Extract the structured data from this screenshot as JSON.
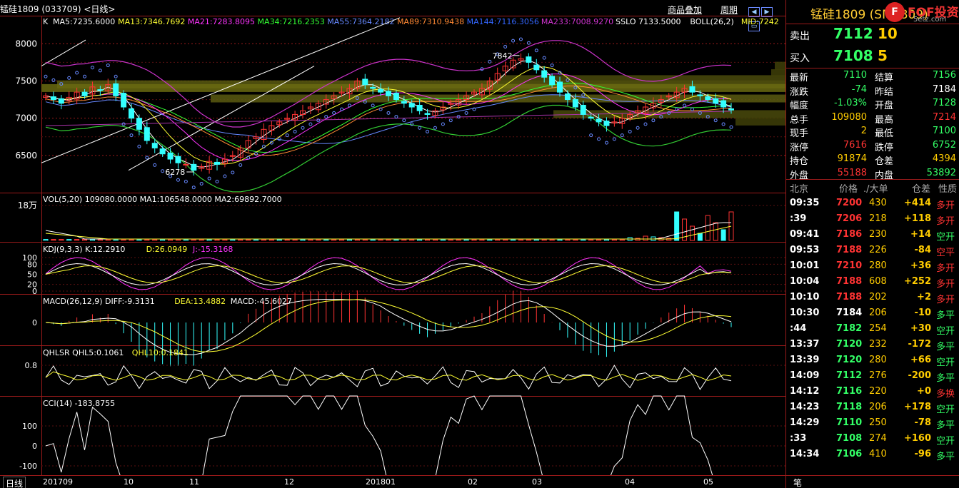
{
  "title": "锰硅1809 (033709) <日线>",
  "toplinks": [
    "商品叠加",
    "周期"
  ],
  "k_panel": {
    "prefix": "K",
    "ma_items": [
      {
        "text": "MA5:7235.6000",
        "color": "#ffffff"
      },
      {
        "text": "MA13:7346.7692",
        "color": "#ffff33"
      },
      {
        "text": "MA21:7283.8095",
        "color": "#ff33ff"
      },
      {
        "text": "MA34:7216.2353",
        "color": "#33ff33"
      },
      {
        "text": "MA55:7364.2182",
        "color": "#6688ff"
      },
      {
        "text": "MA89:7310.9438",
        "color": "#ff8833"
      },
      {
        "text": "MA144:7116.3056",
        "color": "#3366ff"
      },
      {
        "text": "MA233:7008.9270",
        "color": "#cc33cc"
      },
      {
        "text": "SSLO  7133.5000",
        "color": "#ffffff"
      },
      {
        "text": "BOLL(26,2)",
        "color": "#ffffff"
      },
      {
        "text": "MID:7242",
        "color": "#ffff33"
      }
    ],
    "y_ticks": [
      "8000",
      "7500",
      "7000",
      "6500"
    ],
    "annot_high": "7842",
    "annot_low": "6278"
  },
  "vol_panel": {
    "header": "VOL(5,20)  109080.0000  MA1:106548.0000  MA2:69892.7000",
    "y_tick": "18万"
  },
  "kdj_panel": {
    "header_parts": [
      {
        "text": "KDJ(9,3,3)  K:12.2910",
        "color": "#ffffff"
      },
      {
        "text": "D:26.0949",
        "color": "#ffff33"
      },
      {
        "text": "J:-15.3168",
        "color": "#ff33ff"
      }
    ],
    "y_ticks": [
      "100",
      "80",
      "50",
      "20",
      "0"
    ]
  },
  "macd_panel": {
    "header_parts": [
      {
        "text": "MACD(26,12,9)  DIFF:-9.3131",
        "color": "#ffffff"
      },
      {
        "text": "DEA:13.4882",
        "color": "#ffff33"
      },
      {
        "text": "MACD:-45.6027",
        "color": "#ffffff"
      }
    ],
    "y_tick": "0"
  },
  "qhl_panel": {
    "header_parts": [
      {
        "text": "QHLSR  QHL5:0.1061",
        "color": "#ffffff"
      },
      {
        "text": "QHL10:0.1841",
        "color": "#ffff33"
      }
    ],
    "y_tick": "0.8"
  },
  "cci_panel": {
    "header": "CCI(14)  -183.8755",
    "y_ticks": [
      "100",
      "0",
      "-100"
    ]
  },
  "x_labels": [
    "201709",
    "10",
    "11",
    "12",
    "201801",
    "02",
    "03",
    "04",
    "05"
  ],
  "bottom_tab": "日线",
  "right": {
    "name": "锰硅1809 (SM1809)",
    "logo_text": "FOF投资",
    "logo_sub": "5etz.com",
    "ask": {
      "label": "卖出",
      "price": "7112",
      "vol": "10"
    },
    "bid": {
      "label": "买入",
      "price": "7108",
      "vol": "5"
    },
    "stats": [
      {
        "l1": "最新",
        "v1": "7110",
        "c1": "#33ff66",
        "l2": "结算",
        "v2": "7156",
        "c2": "#33ff66"
      },
      {
        "l1": "涨跌",
        "v1": "-74",
        "c1": "#33ff66",
        "l2": "昨结",
        "v2": "7184",
        "c2": "#ffffff"
      },
      {
        "l1": "幅度",
        "v1": "-1.03%",
        "c1": "#33ff66",
        "l2": "开盘",
        "v2": "7128",
        "c2": "#33ff66"
      },
      {
        "l1": "总手",
        "v1": "109080",
        "c1": "#ffcc00",
        "l2": "最高",
        "v2": "7214",
        "c2": "#ff3333"
      },
      {
        "l1": "现手",
        "v1": "2",
        "c1": "#ffcc00",
        "l2": "最低",
        "v2": "7100",
        "c2": "#33ff66"
      },
      {
        "l1": "涨停",
        "v1": "7616",
        "c1": "#ff3333",
        "l2": "跌停",
        "v2": "6752",
        "c2": "#33ff66"
      },
      {
        "l1": "持仓",
        "v1": "91874",
        "c1": "#ffcc00",
        "l2": "仓差",
        "v2": "4394",
        "c2": "#ffcc00"
      },
      {
        "l1": "外盘",
        "v1": "55188",
        "c1": "#ff3333",
        "l2": "内盘",
        "v2": "53892",
        "c2": "#33ff66"
      }
    ],
    "tick_header": [
      "北京",
      "价格",
      "./大单",
      "仓差",
      "性质"
    ],
    "ticks": [
      {
        "t": "09:35",
        "p": "7200",
        "v": "430",
        "d": "+414",
        "n": "多开",
        "pc": "#ff3333",
        "nc": "#ff3333"
      },
      {
        "t": ":39",
        "p": "7206",
        "v": "218",
        "d": "+118",
        "n": "多开",
        "pc": "#ff3333",
        "nc": "#ff3333"
      },
      {
        "t": "09:41",
        "p": "7186",
        "v": "230",
        "d": "+14",
        "n": "空开",
        "pc": "#ff3333",
        "nc": "#33ff66"
      },
      {
        "t": "09:53",
        "p": "7188",
        "v": "226",
        "d": "-84",
        "n": "空平",
        "pc": "#ff3333",
        "nc": "#ff3333"
      },
      {
        "t": "10:01",
        "p": "7210",
        "v": "280",
        "d": "+36",
        "n": "多开",
        "pc": "#ff3333",
        "nc": "#ff3333"
      },
      {
        "t": "10:04",
        "p": "7188",
        "v": "608",
        "d": "+252",
        "n": "多开",
        "pc": "#ff3333",
        "nc": "#ff3333"
      },
      {
        "t": "10:10",
        "p": "7188",
        "v": "202",
        "d": "+2",
        "n": "多开",
        "pc": "#ff3333",
        "nc": "#ff3333"
      },
      {
        "t": "10:30",
        "p": "7184",
        "v": "206",
        "d": "-10",
        "n": "多平",
        "pc": "#ffffff",
        "nc": "#33ff66"
      },
      {
        "t": ":44",
        "p": "7182",
        "v": "254",
        "d": "+30",
        "n": "空开",
        "pc": "#33ff66",
        "nc": "#33ff66"
      },
      {
        "t": "13:37",
        "p": "7120",
        "v": "232",
        "d": "-172",
        "n": "多平",
        "pc": "#33ff66",
        "nc": "#33ff66"
      },
      {
        "t": "13:39",
        "p": "7120",
        "v": "280",
        "d": "+66",
        "n": "空开",
        "pc": "#33ff66",
        "nc": "#33ff66"
      },
      {
        "t": "14:09",
        "p": "7112",
        "v": "276",
        "d": "-200",
        "n": "多平",
        "pc": "#33ff66",
        "nc": "#33ff66"
      },
      {
        "t": "14:12",
        "p": "7116",
        "v": "220",
        "d": "+0",
        "n": "多换",
        "pc": "#33ff66",
        "nc": "#ff3333"
      },
      {
        "t": "14:23",
        "p": "7118",
        "v": "206",
        "d": "+178",
        "n": "空开",
        "pc": "#33ff66",
        "nc": "#33ff66"
      },
      {
        "t": "14:29",
        "p": "7110",
        "v": "250",
        "d": "-78",
        "n": "多平",
        "pc": "#33ff66",
        "nc": "#33ff66"
      },
      {
        "t": ":33",
        "p": "7108",
        "v": "274",
        "d": "+160",
        "n": "空开",
        "pc": "#33ff66",
        "nc": "#33ff66"
      },
      {
        "t": "14:34",
        "p": "7106",
        "v": "410",
        "d": "-96",
        "n": "多平",
        "pc": "#33ff66",
        "nc": "#33ff66"
      }
    ],
    "foot": "笔"
  },
  "chart_data": {
    "type": "candlestick",
    "title": "锰硅1809 (033709) 日线",
    "x_range": [
      "2017-09",
      "2018-05"
    ],
    "price_ylim": [
      6000,
      8300
    ],
    "high": 7842,
    "low": 6278,
    "close_series": [
      7300,
      7250,
      7200,
      7280,
      7350,
      7300,
      7420,
      7380,
      7450,
      7300,
      7150,
      7000,
      6850,
      6700,
      6600,
      6520,
      6450,
      6400,
      6380,
      6300,
      6350,
      6420,
      6380,
      6450,
      6500,
      6600,
      6700,
      6750,
      6850,
      6900,
      6950,
      7000,
      7050,
      7100,
      7150,
      7200,
      7250,
      7300,
      7350,
      7400,
      7500,
      7450,
      7400,
      7350,
      7300,
      7250,
      7200,
      7150,
      7100,
      7050,
      7100,
      7150,
      7200,
      7250,
      7300,
      7350,
      7400,
      7500,
      7600,
      7700,
      7780,
      7800,
      7750,
      7650,
      7550,
      7450,
      7350,
      7250,
      7150,
      7050,
      7000,
      6950,
      6900,
      6950,
      7000,
      7050,
      7100,
      7150,
      7200,
      7250,
      7300,
      7350,
      7400,
      7350,
      7300,
      7250,
      7200,
      7150,
      7110
    ]
  }
}
